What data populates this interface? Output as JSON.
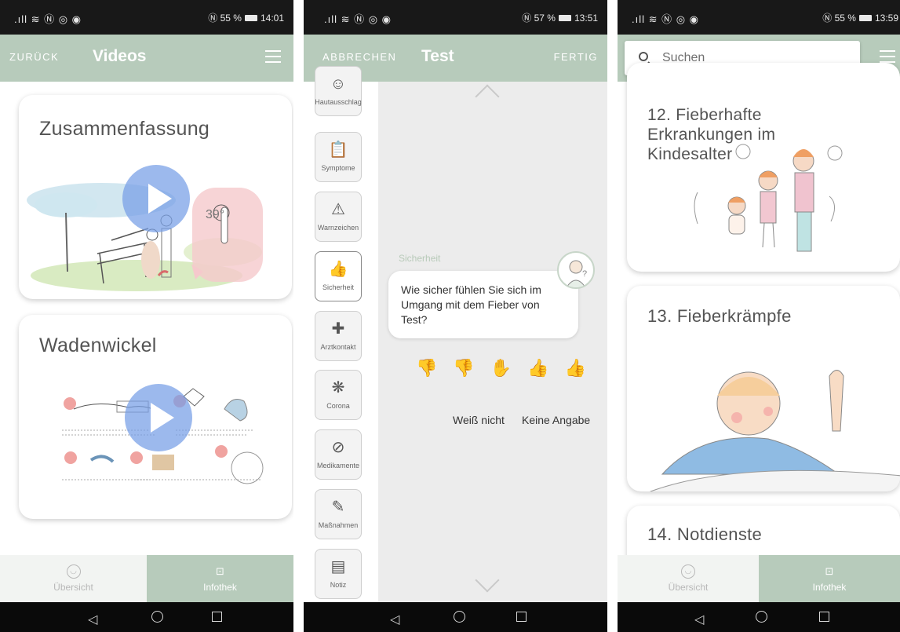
{
  "screens": [
    {
      "status": {
        "left": ".ıll ≋ Ⓝ ◎ ◉",
        "right": "Ⓝ 55 %",
        "time": "14:01"
      },
      "appbar": {
        "back_label": "ZURÜCK",
        "title": "Videos"
      },
      "cards": [
        {
          "title": "Zusammenfassung"
        },
        {
          "title": "Wadenwickel"
        }
      ],
      "tabs": [
        {
          "label": "Übersicht",
          "icon": "smiley-icon"
        },
        {
          "label": "Infothek",
          "icon": "book-icon"
        }
      ]
    },
    {
      "status": {
        "left": ".ıll ≋ Ⓝ ◎ ◉",
        "right": "Ⓝ 57 %",
        "time": "13:51"
      },
      "appbar": {
        "cancel_label": "ABBRECHEN",
        "title": "Test",
        "done_label": "FERTIG"
      },
      "sidebar": [
        {
          "label": "Hautausschlag",
          "glyph": "☺"
        },
        {
          "label": "Symptome",
          "glyph": "📋"
        },
        {
          "label": "Warnzeichen",
          "glyph": "⚠"
        },
        {
          "label": "Sicherheit",
          "glyph": "👍"
        },
        {
          "label": "Arztkontakt",
          "glyph": "✚"
        },
        {
          "label": "Corona",
          "glyph": "❋"
        },
        {
          "label": "Medikamente",
          "glyph": "⊘"
        },
        {
          "label": "Maßnahmen",
          "glyph": "✎"
        },
        {
          "label": "Notiz",
          "glyph": "▤"
        }
      ],
      "question": {
        "caption": "Sicherheit",
        "text": "Wie sicher fühlen Sie sich im Umgang mit dem Fieber von Test?"
      },
      "ratings": [
        {
          "glyph": "👎",
          "color": "#e84f5a"
        },
        {
          "glyph": "👎",
          "color": "#f4a25d"
        },
        {
          "glyph": "✋",
          "color": "#f2c233"
        },
        {
          "glyph": "👍",
          "color": "#a7dc8b"
        },
        {
          "glyph": "👍",
          "color": "#69c765"
        }
      ],
      "options": [
        "Weiß nicht",
        "Keine Angabe"
      ]
    },
    {
      "status": {
        "left": ".ıll ≋ Ⓝ ◎ ◉",
        "right": "Ⓝ 55 %",
        "time": "13:59"
      },
      "search": {
        "placeholder": "Suchen"
      },
      "cards": [
        {
          "title": "12. Fieberhafte Erkrankungen im Kindesalter"
        },
        {
          "title": "13. Fieberkrämpfe"
        },
        {
          "title": "14. Notdienste"
        }
      ],
      "tabs": [
        {
          "label": "Übersicht",
          "icon": "smiley-icon"
        },
        {
          "label": "Infothek",
          "icon": "book-icon"
        }
      ]
    }
  ],
  "navbar": {
    "back_glyph": "◁"
  }
}
